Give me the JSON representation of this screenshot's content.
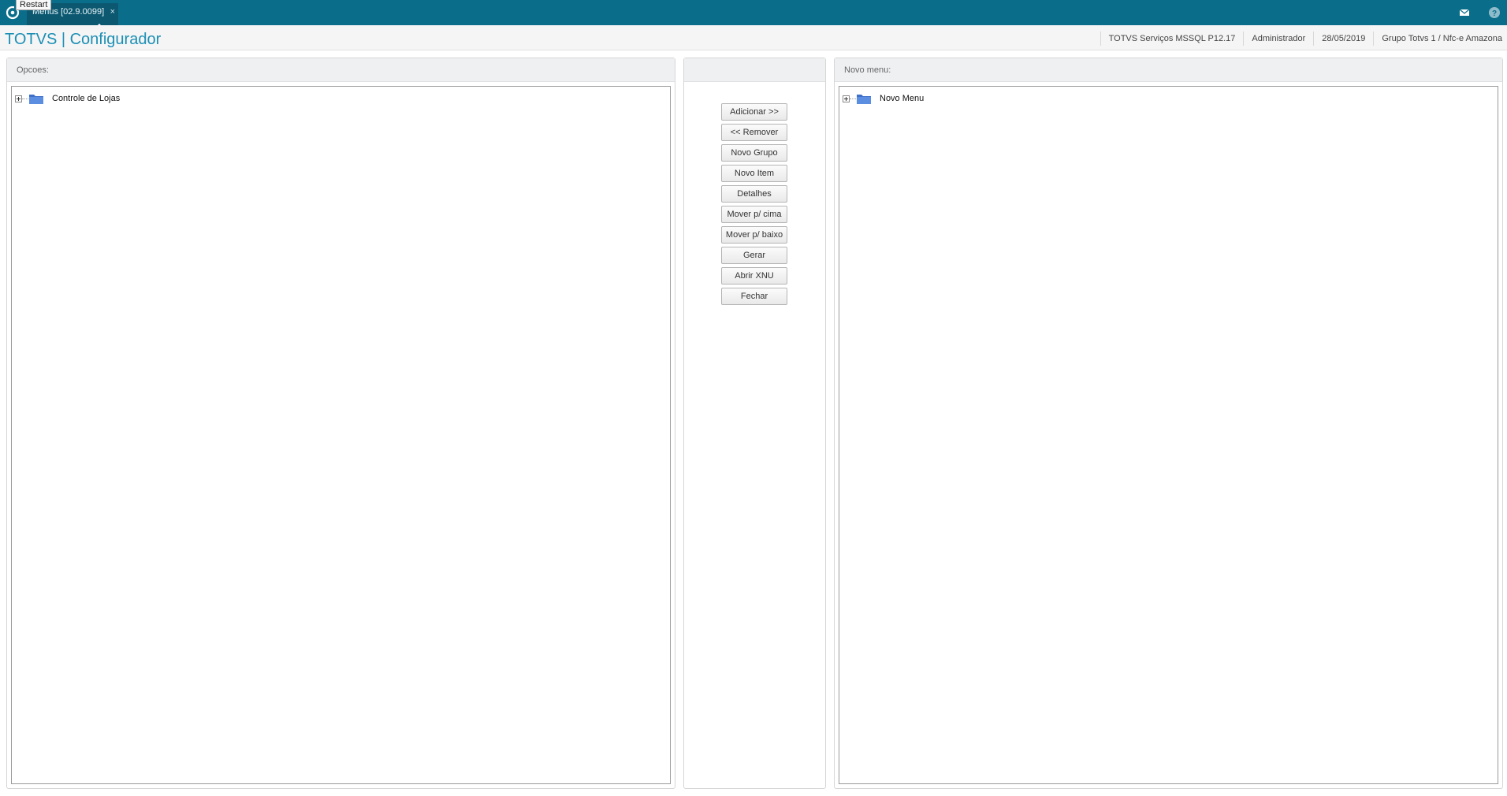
{
  "topbar": {
    "tooltip": "Restart",
    "tab_label": "Menus [02.9.0099]",
    "tab_close": "×",
    "icons": [
      "restart-icon",
      "mail-icon",
      "help-icon"
    ]
  },
  "header": {
    "title": "TOTVS | Configurador",
    "server": "TOTVS Serviços MSSQL P12.17",
    "user": "Administrador",
    "date": "28/05/2019",
    "company": "Grupo Totvs 1 / Nfc-e  Amazona"
  },
  "left_panel": {
    "title": "Opcoes:",
    "tree": [
      {
        "label": "Controle de Lojas",
        "icon": "folder-icon"
      }
    ]
  },
  "actions": {
    "buttons": [
      "Adicionar >>",
      "<< Remover",
      "Novo Grupo",
      "Novo Item",
      "Detalhes",
      "Mover p/ cima",
      "Mover p/ baixo",
      "Gerar",
      "Abrir XNU",
      "Fechar"
    ]
  },
  "right_panel": {
    "title": "Novo menu:",
    "tree": [
      {
        "label": "Novo Menu",
        "icon": "folder-icon"
      }
    ]
  },
  "colors": {
    "topbar": "#0a6e8a",
    "tab_active": "#0b5870",
    "title_accent": "#1c8fb5"
  }
}
